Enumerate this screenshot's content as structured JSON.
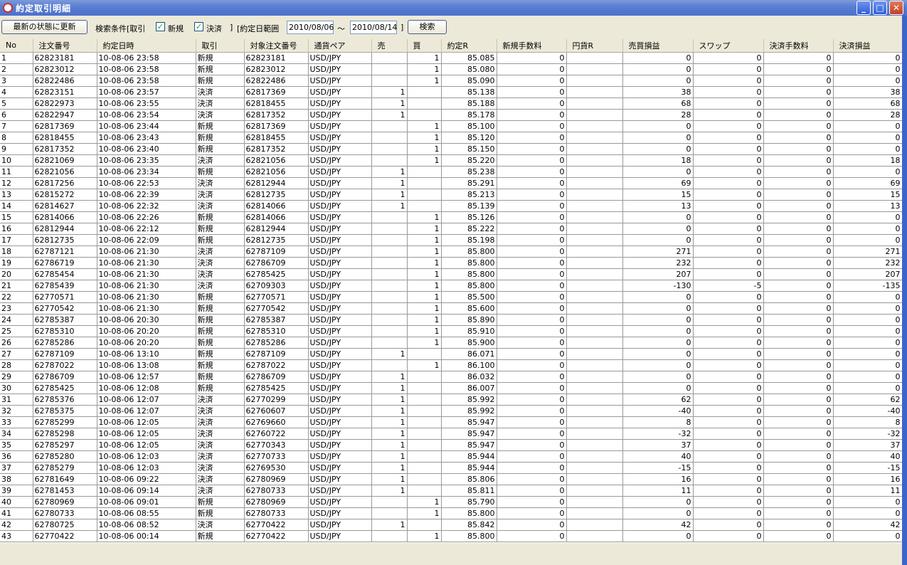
{
  "window": {
    "title": "約定取引明細",
    "minimize": "_",
    "maximize": "□",
    "close": "✕"
  },
  "toolbar": {
    "refresh_label": "最新の状態に更新",
    "search_cond_label": "検索条件[取引",
    "new_label": "新規",
    "new_checked": true,
    "settle_label": "決済",
    "settle_checked": true,
    "close_bracket": "]",
    "date_range_label": "[約定日範囲",
    "date_from": "2010/08/06",
    "tilde": "～",
    "date_to": "2010/08/14",
    "close_bracket2": "]",
    "search_label": "検索",
    "check_mark": "✓"
  },
  "table": {
    "columns": [
      "No",
      "注文番号",
      "約定日時",
      "取引",
      "対象注文番号",
      "通貨ペア",
      "売",
      "買",
      "約定R",
      "新規手数料",
      "円貨R",
      "売買損益",
      "スワップ",
      "決済手数料",
      "決済損益"
    ],
    "rows": [
      [
        "1",
        "62823181",
        "10-08-06 23:58",
        "新規",
        "62823181",
        "USD/JPY",
        "",
        "1",
        "85.085",
        "0",
        "",
        "0",
        "0",
        "0",
        "0"
      ],
      [
        "2",
        "62823012",
        "10-08-06 23:58",
        "新規",
        "62823012",
        "USD/JPY",
        "",
        "1",
        "85.080",
        "0",
        "",
        "0",
        "0",
        "0",
        "0"
      ],
      [
        "3",
        "62822486",
        "10-08-06 23:58",
        "新規",
        "62822486",
        "USD/JPY",
        "",
        "1",
        "85.090",
        "0",
        "",
        "0",
        "0",
        "0",
        "0"
      ],
      [
        "4",
        "62823151",
        "10-08-06 23:57",
        "決済",
        "62817369",
        "USD/JPY",
        "1",
        "",
        "85.138",
        "0",
        "",
        "38",
        "0",
        "0",
        "38"
      ],
      [
        "5",
        "62822973",
        "10-08-06 23:55",
        "決済",
        "62818455",
        "USD/JPY",
        "1",
        "",
        "85.188",
        "0",
        "",
        "68",
        "0",
        "0",
        "68"
      ],
      [
        "6",
        "62822947",
        "10-08-06 23:54",
        "決済",
        "62817352",
        "USD/JPY",
        "1",
        "",
        "85.178",
        "0",
        "",
        "28",
        "0",
        "0",
        "28"
      ],
      [
        "7",
        "62817369",
        "10-08-06 23:44",
        "新規",
        "62817369",
        "USD/JPY",
        "",
        "1",
        "85.100",
        "0",
        "",
        "0",
        "0",
        "0",
        "0"
      ],
      [
        "8",
        "62818455",
        "10-08-06 23:43",
        "新規",
        "62818455",
        "USD/JPY",
        "",
        "1",
        "85.120",
        "0",
        "",
        "0",
        "0",
        "0",
        "0"
      ],
      [
        "9",
        "62817352",
        "10-08-06 23:40",
        "新規",
        "62817352",
        "USD/JPY",
        "",
        "1",
        "85.150",
        "0",
        "",
        "0",
        "0",
        "0",
        "0"
      ],
      [
        "10",
        "62821069",
        "10-08-06 23:35",
        "決済",
        "62821056",
        "USD/JPY",
        "",
        "1",
        "85.220",
        "0",
        "",
        "18",
        "0",
        "0",
        "18"
      ],
      [
        "11",
        "62821056",
        "10-08-06 23:34",
        "新規",
        "62821056",
        "USD/JPY",
        "1",
        "",
        "85.238",
        "0",
        "",
        "0",
        "0",
        "0",
        "0"
      ],
      [
        "12",
        "62817256",
        "10-08-06 22:53",
        "決済",
        "62812944",
        "USD/JPY",
        "1",
        "",
        "85.291",
        "0",
        "",
        "69",
        "0",
        "0",
        "69"
      ],
      [
        "13",
        "62815272",
        "10-08-06 22:39",
        "決済",
        "62812735",
        "USD/JPY",
        "1",
        "",
        "85.213",
        "0",
        "",
        "15",
        "0",
        "0",
        "15"
      ],
      [
        "14",
        "62814627",
        "10-08-06 22:32",
        "決済",
        "62814066",
        "USD/JPY",
        "1",
        "",
        "85.139",
        "0",
        "",
        "13",
        "0",
        "0",
        "13"
      ],
      [
        "15",
        "62814066",
        "10-08-06 22:26",
        "新規",
        "62814066",
        "USD/JPY",
        "",
        "1",
        "85.126",
        "0",
        "",
        "0",
        "0",
        "0",
        "0"
      ],
      [
        "16",
        "62812944",
        "10-08-06 22:12",
        "新規",
        "62812944",
        "USD/JPY",
        "",
        "1",
        "85.222",
        "0",
        "",
        "0",
        "0",
        "0",
        "0"
      ],
      [
        "17",
        "62812735",
        "10-08-06 22:09",
        "新規",
        "62812735",
        "USD/JPY",
        "",
        "1",
        "85.198",
        "0",
        "",
        "0",
        "0",
        "0",
        "0"
      ],
      [
        "18",
        "62787121",
        "10-08-06 21:30",
        "決済",
        "62787109",
        "USD/JPY",
        "",
        "1",
        "85.800",
        "0",
        "",
        "271",
        "0",
        "0",
        "271"
      ],
      [
        "19",
        "62786719",
        "10-08-06 21:30",
        "決済",
        "62786709",
        "USD/JPY",
        "",
        "1",
        "85.800",
        "0",
        "",
        "232",
        "0",
        "0",
        "232"
      ],
      [
        "20",
        "62785454",
        "10-08-06 21:30",
        "決済",
        "62785425",
        "USD/JPY",
        "",
        "1",
        "85.800",
        "0",
        "",
        "207",
        "0",
        "0",
        "207"
      ],
      [
        "21",
        "62785439",
        "10-08-06 21:30",
        "決済",
        "62709303",
        "USD/JPY",
        "",
        "1",
        "85.800",
        "0",
        "",
        "-130",
        "-5",
        "0",
        "-135"
      ],
      [
        "22",
        "62770571",
        "10-08-06 21:30",
        "新規",
        "62770571",
        "USD/JPY",
        "",
        "1",
        "85.500",
        "0",
        "",
        "0",
        "0",
        "0",
        "0"
      ],
      [
        "23",
        "62770542",
        "10-08-06 21:30",
        "新規",
        "62770542",
        "USD/JPY",
        "",
        "1",
        "85.600",
        "0",
        "",
        "0",
        "0",
        "0",
        "0"
      ],
      [
        "24",
        "62785387",
        "10-08-06 20:30",
        "新規",
        "62785387",
        "USD/JPY",
        "",
        "1",
        "85.890",
        "0",
        "",
        "0",
        "0",
        "0",
        "0"
      ],
      [
        "25",
        "62785310",
        "10-08-06 20:20",
        "新規",
        "62785310",
        "USD/JPY",
        "",
        "1",
        "85.910",
        "0",
        "",
        "0",
        "0",
        "0",
        "0"
      ],
      [
        "26",
        "62785286",
        "10-08-06 20:20",
        "新規",
        "62785286",
        "USD/JPY",
        "",
        "1",
        "85.900",
        "0",
        "",
        "0",
        "0",
        "0",
        "0"
      ],
      [
        "27",
        "62787109",
        "10-08-06 13:10",
        "新規",
        "62787109",
        "USD/JPY",
        "1",
        "",
        "86.071",
        "0",
        "",
        "0",
        "0",
        "0",
        "0"
      ],
      [
        "28",
        "62787022",
        "10-08-06 13:08",
        "新規",
        "62787022",
        "USD/JPY",
        "",
        "1",
        "86.100",
        "0",
        "",
        "0",
        "0",
        "0",
        "0"
      ],
      [
        "29",
        "62786709",
        "10-08-06 12:57",
        "新規",
        "62786709",
        "USD/JPY",
        "1",
        "",
        "86.032",
        "0",
        "",
        "0",
        "0",
        "0",
        "0"
      ],
      [
        "30",
        "62785425",
        "10-08-06 12:08",
        "新規",
        "62785425",
        "USD/JPY",
        "1",
        "",
        "86.007",
        "0",
        "",
        "0",
        "0",
        "0",
        "0"
      ],
      [
        "31",
        "62785376",
        "10-08-06 12:07",
        "決済",
        "62770299",
        "USD/JPY",
        "1",
        "",
        "85.992",
        "0",
        "",
        "62",
        "0",
        "0",
        "62"
      ],
      [
        "32",
        "62785375",
        "10-08-06 12:07",
        "決済",
        "62760607",
        "USD/JPY",
        "1",
        "",
        "85.992",
        "0",
        "",
        "-40",
        "0",
        "0",
        "-40"
      ],
      [
        "33",
        "62785299",
        "10-08-06 12:05",
        "決済",
        "62769660",
        "USD/JPY",
        "1",
        "",
        "85.947",
        "0",
        "",
        "8",
        "0",
        "0",
        "8"
      ],
      [
        "34",
        "62785298",
        "10-08-06 12:05",
        "決済",
        "62760722",
        "USD/JPY",
        "1",
        "",
        "85.947",
        "0",
        "",
        "-32",
        "0",
        "0",
        "-32"
      ],
      [
        "35",
        "62785297",
        "10-08-06 12:05",
        "決済",
        "62770343",
        "USD/JPY",
        "1",
        "",
        "85.947",
        "0",
        "",
        "37",
        "0",
        "0",
        "37"
      ],
      [
        "36",
        "62785280",
        "10-08-06 12:03",
        "決済",
        "62770733",
        "USD/JPY",
        "1",
        "",
        "85.944",
        "0",
        "",
        "40",
        "0",
        "0",
        "40"
      ],
      [
        "37",
        "62785279",
        "10-08-06 12:03",
        "決済",
        "62769530",
        "USD/JPY",
        "1",
        "",
        "85.944",
        "0",
        "",
        "-15",
        "0",
        "0",
        "-15"
      ],
      [
        "38",
        "62781649",
        "10-08-06 09:22",
        "決済",
        "62780969",
        "USD/JPY",
        "1",
        "",
        "85.806",
        "0",
        "",
        "16",
        "0",
        "0",
        "16"
      ],
      [
        "39",
        "62781453",
        "10-08-06 09:14",
        "決済",
        "62780733",
        "USD/JPY",
        "1",
        "",
        "85.811",
        "0",
        "",
        "11",
        "0",
        "0",
        "11"
      ],
      [
        "40",
        "62780969",
        "10-08-06 09:01",
        "新規",
        "62780969",
        "USD/JPY",
        "",
        "1",
        "85.790",
        "0",
        "",
        "0",
        "0",
        "0",
        "0"
      ],
      [
        "41",
        "62780733",
        "10-08-06 08:55",
        "新規",
        "62780733",
        "USD/JPY",
        "",
        "1",
        "85.800",
        "0",
        "",
        "0",
        "0",
        "0",
        "0"
      ],
      [
        "42",
        "62780725",
        "10-08-06 08:52",
        "決済",
        "62770422",
        "USD/JPY",
        "1",
        "",
        "85.842",
        "0",
        "",
        "42",
        "0",
        "0",
        "42"
      ],
      [
        "43",
        "62770422",
        "10-08-06 00:14",
        "新規",
        "62770422",
        "USD/JPY",
        "",
        "1",
        "85.800",
        "0",
        "",
        "0",
        "0",
        "0",
        "0"
      ]
    ]
  }
}
